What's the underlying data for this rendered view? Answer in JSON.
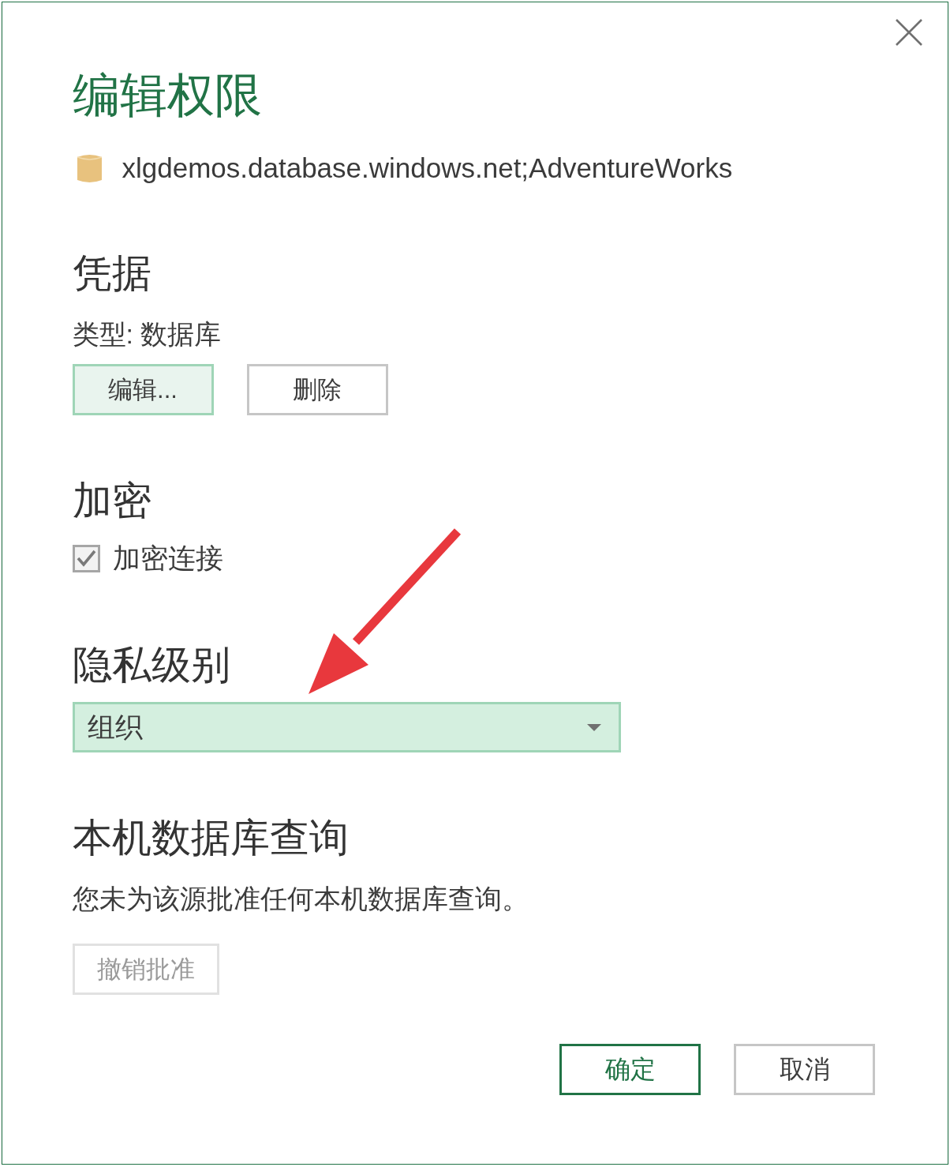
{
  "dialog": {
    "title": "编辑权限"
  },
  "source": {
    "text": "xlgdemos.database.windows.net;AdventureWorks"
  },
  "credentials": {
    "heading": "凭据",
    "type_text": "类型: 数据库",
    "buttons": [
      {
        "label": "编辑...",
        "highlighted": true
      },
      {
        "label": "删除",
        "highlighted": false
      }
    ]
  },
  "encryption": {
    "heading": "加密",
    "checkbox": {
      "label": "加密连接",
      "checked": true
    }
  },
  "privacy_level": {
    "heading": "隐私级别",
    "dropdown": {
      "value": "组织",
      "highlighted": true
    }
  },
  "native_queries": {
    "heading": "本机数据库查询",
    "text": "您未为该源批准任何本机数据库查询。",
    "revoke_button": {
      "label": "撤销批准",
      "disabled": true
    }
  },
  "footer_buttons": [
    {
      "label": "确定",
      "default": true
    },
    {
      "label": "取消",
      "default": false
    }
  ]
}
